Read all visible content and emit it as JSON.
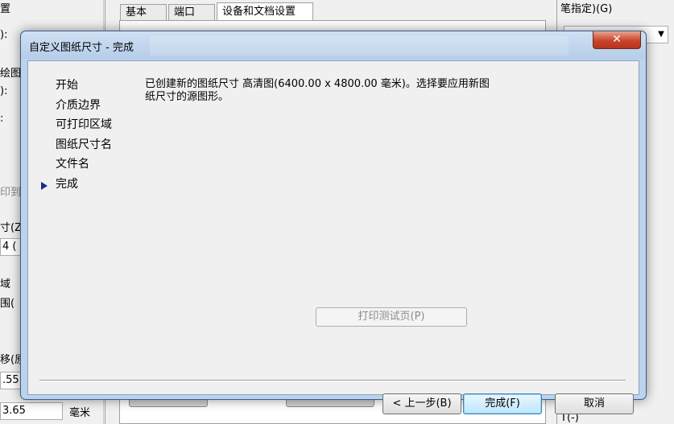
{
  "background": {
    "tabs": [
      "基本",
      "端口",
      "设备和文档设置"
    ],
    "right_label": "笔指定)(G)",
    "right_bottom_label": "T(-)",
    "left_fragments": [
      "置",
      "):",
      "绘图",
      "):",
      ":",
      "印到",
      "寸(Z",
      "4 (",
      "域",
      "围(",
      "移(原",
      ".55",
      "3.65",
      "毫米"
    ]
  },
  "dialog": {
    "title": "自定义图纸尺寸 - 完成",
    "close_symbol": "✕",
    "steps": [
      {
        "label": "开始",
        "current": false
      },
      {
        "label": "介质边界",
        "current": false
      },
      {
        "label": "可打印区域",
        "current": false
      },
      {
        "label": "图纸尺寸名",
        "current": false
      },
      {
        "label": "文件名",
        "current": false
      },
      {
        "label": "完成",
        "current": true
      }
    ],
    "message": "已创建新的图纸尺寸 高清图(6400.00 x 4800.00 毫米)。选择要应用新图纸尺寸的源图形。",
    "test_button": "打印测试页(P)",
    "buttons": {
      "back": "< 上一步(B)",
      "finish": "完成(F)",
      "cancel": "取消"
    }
  }
}
